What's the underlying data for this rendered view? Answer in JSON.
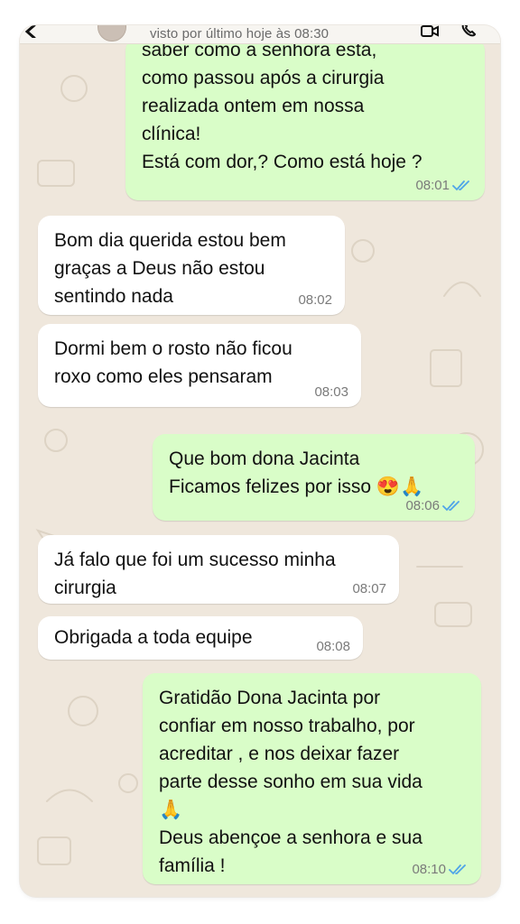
{
  "header": {
    "status": "visto por último hoje às 08:30"
  },
  "icons": {
    "back": "chevron-left-icon",
    "avatar": "contact-avatar",
    "video": "video-call-icon",
    "call": "phone-call-icon",
    "read_receipt": "double-check-icon",
    "accent_read": "#4fa4e8",
    "bubble_out": "#d9fdc8",
    "bubble_in": "#ffffff",
    "wallpaper": "#efe7dc"
  },
  "messages": [
    {
      "direction": "outgoing",
      "text": "saber como a senhora está,\ncomo passou após a cirurgia\nrealizada ontem em nossa\nclínica!\nEstá com dor,? Como está hoje ?",
      "time": "08:01",
      "read": true
    },
    {
      "direction": "incoming",
      "text": "Bom dia querida estou bem\ngraças a Deus não estou\nsentindo nada",
      "time": "08:02"
    },
    {
      "direction": "incoming",
      "text": "Dormi bem  o rosto não ficou\nroxo como eles pensaram",
      "time": "08:03"
    },
    {
      "direction": "outgoing",
      "text": "Que bom dona Jacinta\nFicamos felizes por isso 😍🙏",
      "time": "08:06",
      "read": true
    },
    {
      "direction": "incoming",
      "text": "Já falo que foi um sucesso minha\ncirurgia",
      "time": "08:07"
    },
    {
      "direction": "incoming",
      "text": "Obrigada a toda equipe",
      "time": "08:08"
    },
    {
      "direction": "outgoing",
      "text": "Gratidão Dona Jacinta por\nconfiar em nosso trabalho, por\nacreditar , e nos deixar fazer\nparte desse sonho em sua vida\n🙏\nDeus abençoe a senhora e sua\nfamília !",
      "time": "08:10",
      "read": true
    }
  ]
}
